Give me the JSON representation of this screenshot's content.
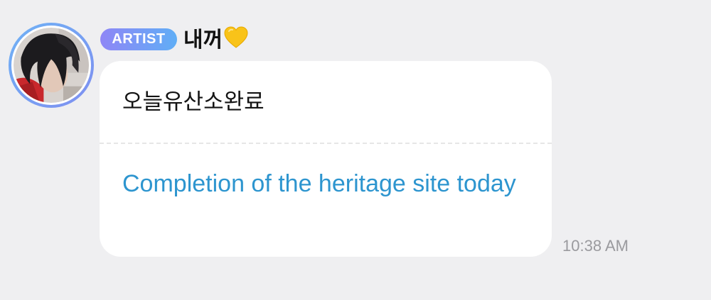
{
  "sender": {
    "badge": "ARTIST",
    "nickname": "내꺼",
    "nickname_icon": "yellow-heart-icon",
    "avatar": "profile-photo"
  },
  "message": {
    "original_text": "오늘유산소완료",
    "translated_text": "Completion of the heritage site today",
    "time": "10:38 AM"
  },
  "colors": {
    "background": "#efeff1",
    "bubble": "#ffffff",
    "translation": "#2d95cf",
    "badge_start": "#8f86f6",
    "badge_end": "#60aef6",
    "avatar_ring": "#6fb2f5",
    "heart": "#f9c319",
    "timestamp": "#9a9a9e"
  }
}
